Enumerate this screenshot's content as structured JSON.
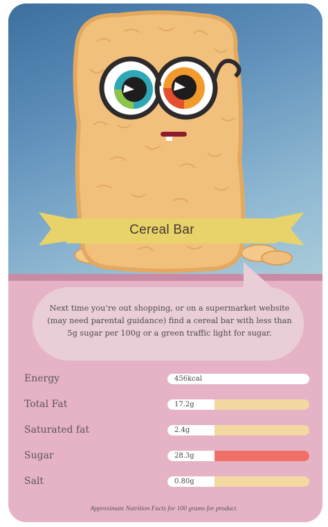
{
  "product_name": "Cereal Bar",
  "advice": "Next time you’re out shopping, or on a supermarket website (may need parental guidance) find a cereal bar with less than 5g sugar per 100g or a green traffic light for sugar.",
  "nutrition": [
    {
      "label": "Energy",
      "value": "456kcal",
      "level_color": "#ffffff"
    },
    {
      "label": "Total Fat",
      "value": "17.2g",
      "level_color": "#f3d8a1"
    },
    {
      "label": "Saturated fat",
      "value": "2.4g",
      "level_color": "#f3d8a1"
    },
    {
      "label": "Sugar",
      "value": "28.3g",
      "level_color": "#f07068"
    },
    {
      "label": "Salt",
      "value": "0.80g",
      "level_color": "#f3d8a1"
    }
  ],
  "footnote": "Approximate Nutrition Facts for 100 grams for product.",
  "colors": {
    "sky": "#5e8fba",
    "card": "#e6b3c6",
    "banner": "#e8d36a",
    "amber": "#f3d8a1",
    "red": "#f07068"
  }
}
